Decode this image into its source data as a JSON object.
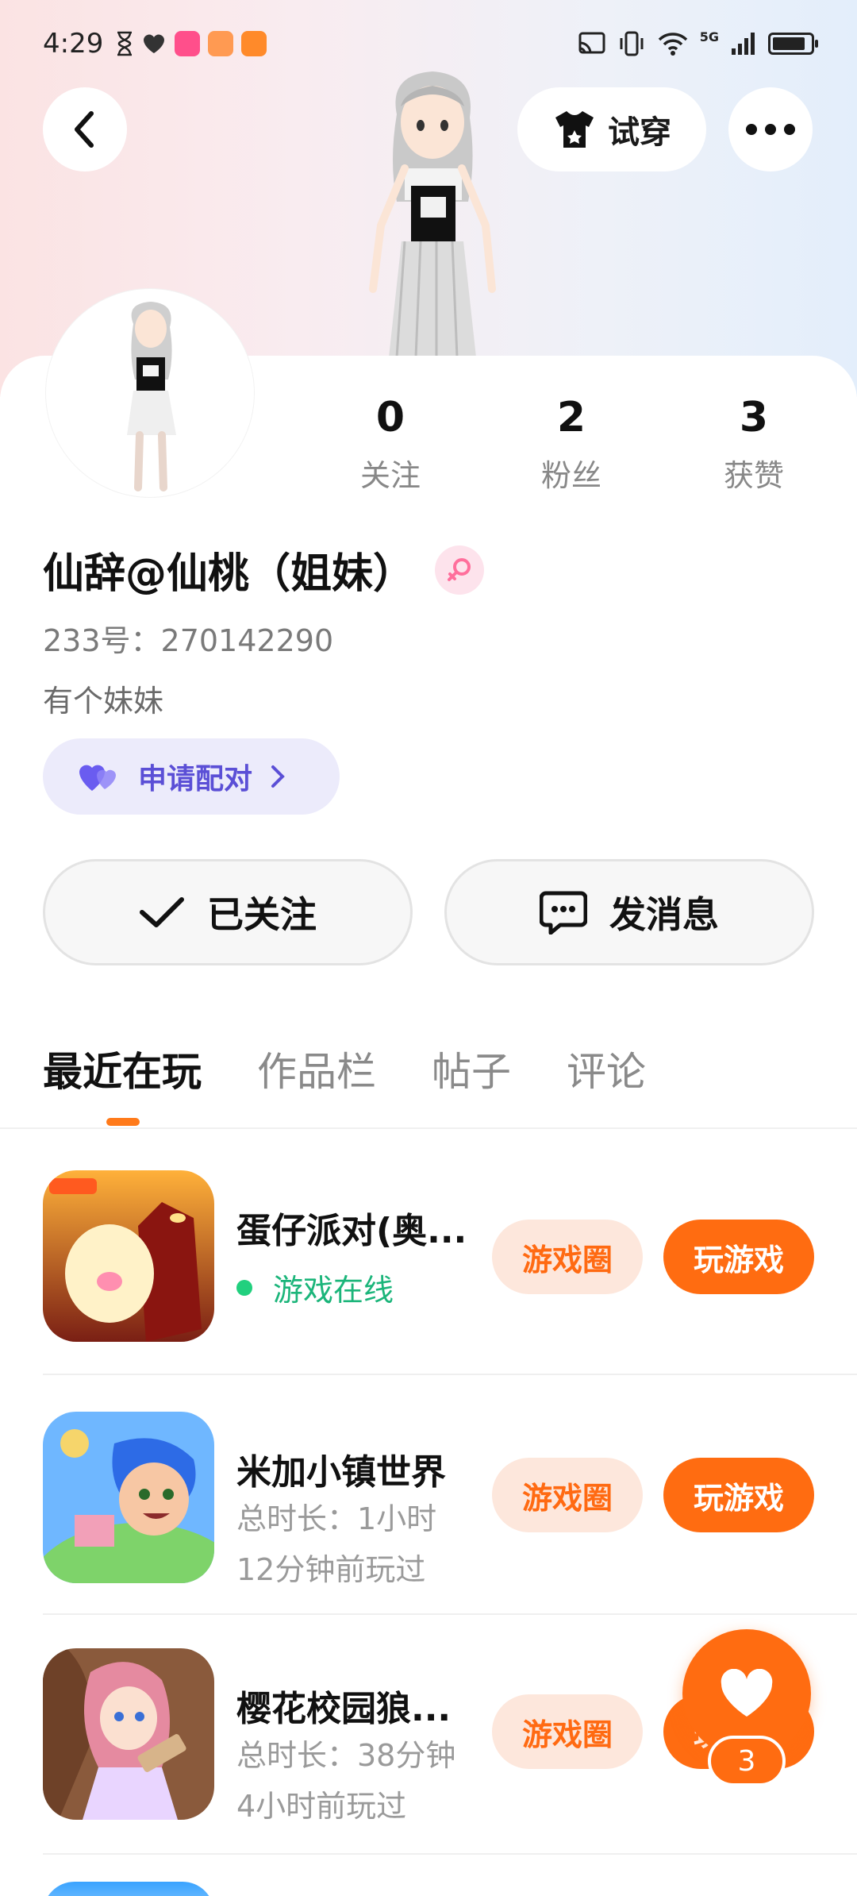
{
  "status_bar": {
    "time": "4:29",
    "network": "5G"
  },
  "header": {
    "try_on_label": "试穿"
  },
  "profile": {
    "stats": [
      {
        "value": "0",
        "label": "关注"
      },
      {
        "value": "2",
        "label": "粉丝"
      },
      {
        "value": "3",
        "label": "获赞"
      }
    ],
    "username": "仙辞@仙桃（姐妹）",
    "uid": "233号：270142290",
    "bio": "有个妹妹",
    "pair_button": "申请配对",
    "follow_button": "已关注",
    "message_button": "发消息"
  },
  "tabs": [
    {
      "label": "最近在玩",
      "active": true
    },
    {
      "label": "作品栏",
      "active": false
    },
    {
      "label": "帖子",
      "active": false
    },
    {
      "label": "评论",
      "active": false
    }
  ],
  "games": [
    {
      "title": "蛋仔派对(奥...",
      "line1": "游戏在线",
      "line2": "",
      "online": true,
      "circle": "游戏圈",
      "play": "玩游戏"
    },
    {
      "title": "米加小镇世界",
      "line1": "总时长：1小时",
      "line2": "12分钟前玩过",
      "online": false,
      "circle": "游戏圈",
      "play": "玩游戏"
    },
    {
      "title": "樱花校园狼...",
      "line1": "总时长：38分钟",
      "line2": "4小时前玩过",
      "online": false,
      "circle": "游戏圈",
      "play": "玩游戏"
    }
  ],
  "fab": {
    "count": "3"
  },
  "colors": {
    "accent": "#ff6c11",
    "pair_purple": "#5b4fd6",
    "online_green": "#1bb57a"
  }
}
